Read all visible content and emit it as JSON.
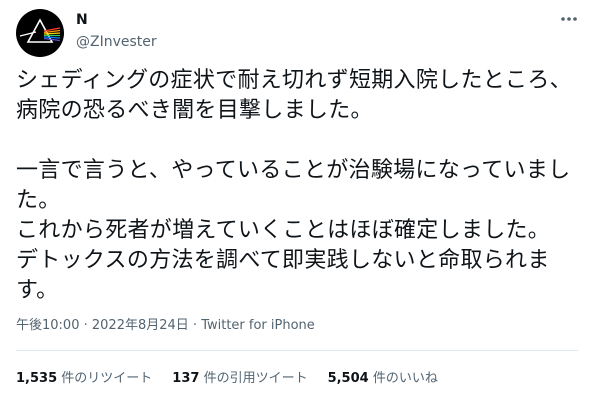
{
  "author": {
    "name": "N",
    "handle": "@ZInvester"
  },
  "tweet": {
    "text": "シェディングの症状で耐え切れず短期入院したところ、病院の恐るべき闇を目撃しました。\n\n一言で言うと、やっていることが治験場になっていました。\nこれから死者が増えていくことはほぼ確定しました。\nデトックスの方法を調べて即実践しないと命取られます。",
    "time": "午後10:00",
    "date": "2022年8月24日",
    "source": "Twitter for iPhone"
  },
  "stats": {
    "retweets": {
      "count": "1,535",
      "label": "件のリツイート"
    },
    "quotes": {
      "count": "137",
      "label": "件の引用ツイート"
    },
    "likes": {
      "count": "5,504",
      "label": "件のいいね"
    }
  },
  "icons": {
    "avatar": "prism-avatar",
    "more": "more-dots-icon"
  }
}
